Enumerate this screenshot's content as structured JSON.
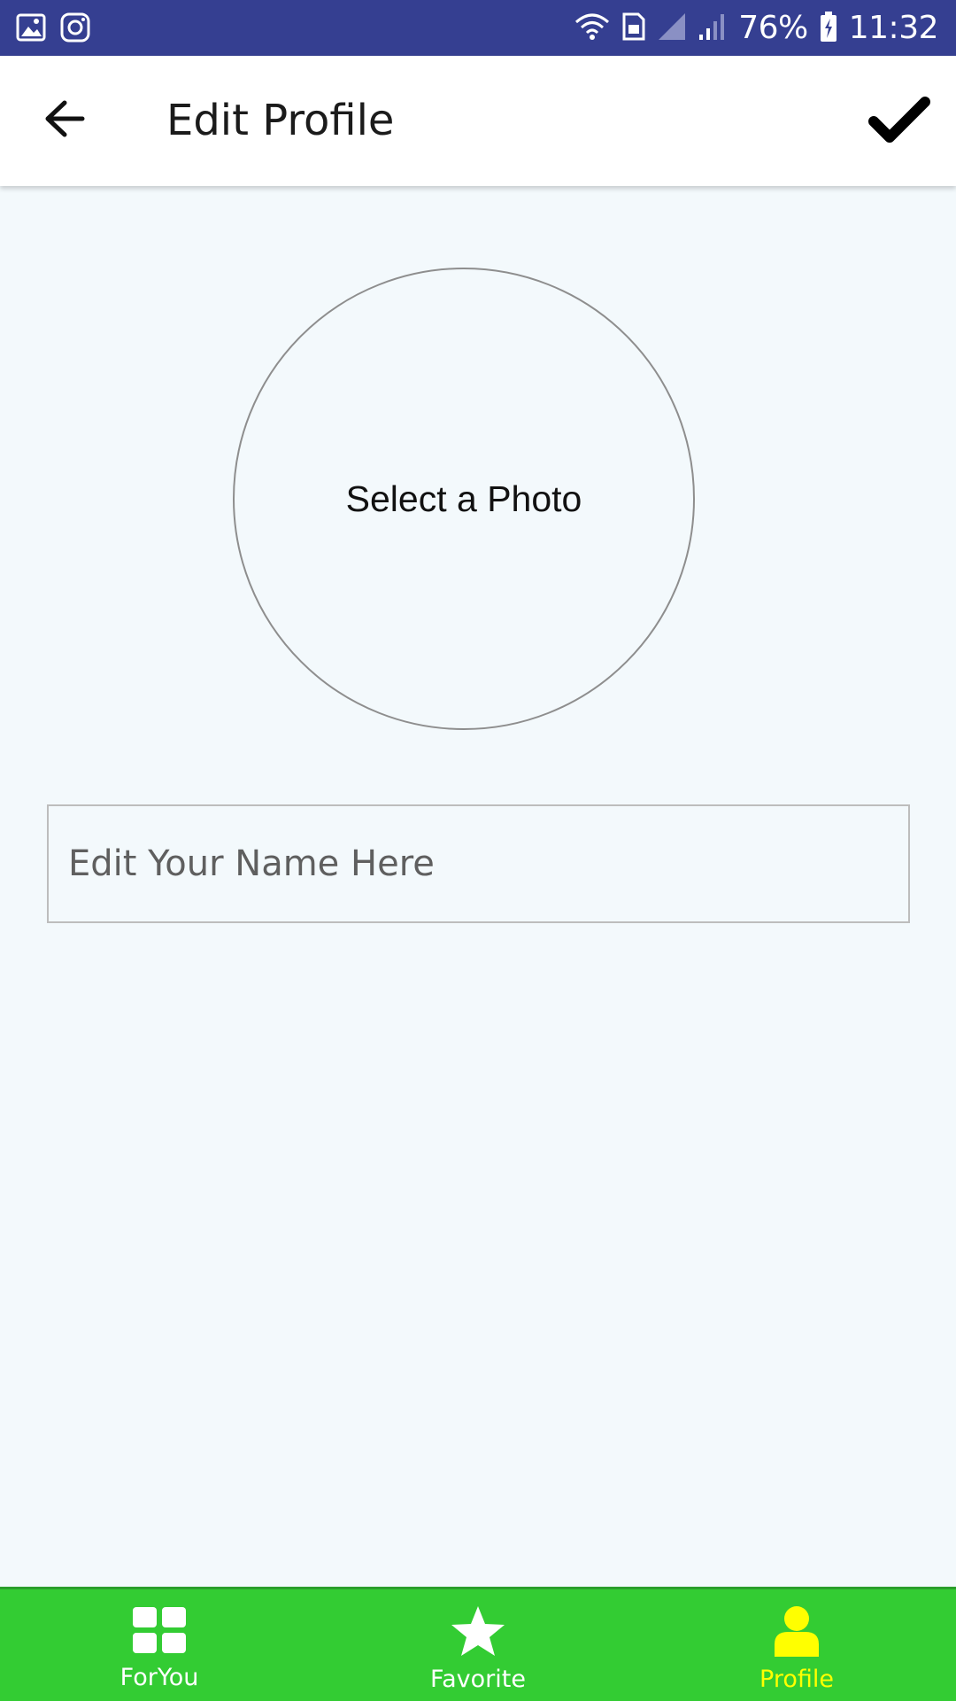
{
  "status_bar": {
    "battery_percent": "76%",
    "time": "11:32",
    "icons": [
      "gallery-icon",
      "instagram-icon",
      "wifi-icon",
      "sim-icon",
      "signal-icon",
      "signal-icon",
      "battery-charging-icon"
    ]
  },
  "app_bar": {
    "title": "Edit Profile",
    "back_icon": "arrow-left-icon",
    "confirm_icon": "checkmark-icon"
  },
  "photo": {
    "label": "Select a Photo"
  },
  "name_input": {
    "placeholder": "Edit Your Name Here",
    "value": ""
  },
  "bottom_nav": {
    "items": [
      {
        "label": "ForYou",
        "icon": "grid-icon",
        "active": false
      },
      {
        "label": "Favorite",
        "icon": "star-icon",
        "active": false
      },
      {
        "label": "Profile",
        "icon": "person-icon",
        "active": true
      }
    ]
  },
  "colors": {
    "status_bar": "#353f91",
    "background": "#f3f9fc",
    "nav_bar": "#33cc33",
    "nav_active": "#ffff00",
    "nav_inactive": "#ffffff"
  }
}
